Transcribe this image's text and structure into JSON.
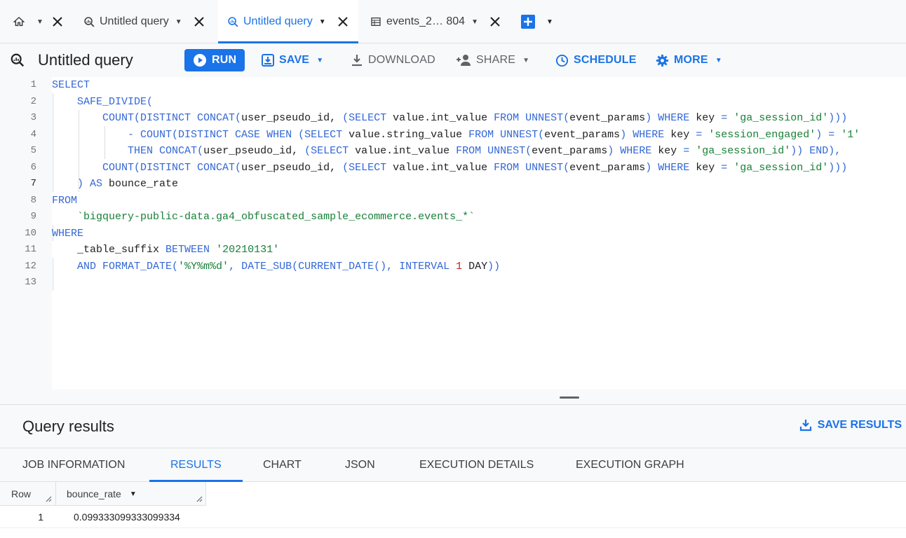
{
  "tabs": [
    {
      "label": "",
      "icon": "home-icon",
      "has_caret": true,
      "active": false
    },
    {
      "label": "Untitled query",
      "icon": "query-icon",
      "has_caret": true,
      "active": false
    },
    {
      "label": "Untitled query",
      "icon": "query-icon",
      "has_caret": true,
      "active": true
    },
    {
      "label": "events_2… 804",
      "icon": "table-icon",
      "has_caret": true,
      "active": false
    }
  ],
  "toolbar": {
    "title": "Untitled query",
    "run": "RUN",
    "save": "SAVE",
    "download": "DOWNLOAD",
    "share": "SHARE",
    "schedule": "SCHEDULE",
    "more": "MORE"
  },
  "editor": {
    "line_numbers": [
      "1",
      "2",
      "3",
      "4",
      "5",
      "6",
      "7",
      "8",
      "9",
      "10",
      "11",
      "12",
      "13"
    ],
    "lines": [
      [
        {
          "t": "SELECT",
          "c": "kw"
        }
      ],
      [
        {
          "t": "    ",
          "c": "tx"
        },
        {
          "t": "SAFE_DIVIDE(",
          "c": "kw"
        }
      ],
      [
        {
          "t": "        ",
          "c": "tx"
        },
        {
          "t": "COUNT(DISTINCT CONCAT(",
          "c": "kw"
        },
        {
          "t": "user_pseudo_id, ",
          "c": "tx"
        },
        {
          "t": "(SELECT ",
          "c": "kw"
        },
        {
          "t": "value.int_value ",
          "c": "tx"
        },
        {
          "t": "FROM UNNEST(",
          "c": "kw"
        },
        {
          "t": "event_params",
          "c": "tx"
        },
        {
          "t": ") WHERE ",
          "c": "kw"
        },
        {
          "t": "key ",
          "c": "tx"
        },
        {
          "t": "= ",
          "c": "kw"
        },
        {
          "t": "'ga_session_id'",
          "c": "st"
        },
        {
          "t": ")))",
          "c": "kw"
        }
      ],
      [
        {
          "t": "            ",
          "c": "tx"
        },
        {
          "t": "- COUNT(DISTINCT CASE WHEN (SELECT ",
          "c": "kw"
        },
        {
          "t": "value.string_value ",
          "c": "tx"
        },
        {
          "t": "FROM UNNEST(",
          "c": "kw"
        },
        {
          "t": "event_params",
          "c": "tx"
        },
        {
          "t": ") WHERE ",
          "c": "kw"
        },
        {
          "t": "key ",
          "c": "tx"
        },
        {
          "t": "= ",
          "c": "kw"
        },
        {
          "t": "'session_engaged'",
          "c": "st"
        },
        {
          "t": ") = ",
          "c": "kw"
        },
        {
          "t": "'1'",
          "c": "st"
        }
      ],
      [
        {
          "t": "            ",
          "c": "tx"
        },
        {
          "t": "THEN CONCAT(",
          "c": "kw"
        },
        {
          "t": "user_pseudo_id, ",
          "c": "tx"
        },
        {
          "t": "(SELECT ",
          "c": "kw"
        },
        {
          "t": "value.int_value ",
          "c": "tx"
        },
        {
          "t": "FROM UNNEST(",
          "c": "kw"
        },
        {
          "t": "event_params",
          "c": "tx"
        },
        {
          "t": ") WHERE ",
          "c": "kw"
        },
        {
          "t": "key ",
          "c": "tx"
        },
        {
          "t": "= ",
          "c": "kw"
        },
        {
          "t": "'ga_session_id'",
          "c": "st"
        },
        {
          "t": ")) END),",
          "c": "kw"
        }
      ],
      [
        {
          "t": "        ",
          "c": "tx"
        },
        {
          "t": "COUNT(DISTINCT CONCAT(",
          "c": "kw"
        },
        {
          "t": "user_pseudo_id, ",
          "c": "tx"
        },
        {
          "t": "(SELECT ",
          "c": "kw"
        },
        {
          "t": "value.int_value ",
          "c": "tx"
        },
        {
          "t": "FROM UNNEST(",
          "c": "kw"
        },
        {
          "t": "event_params",
          "c": "tx"
        },
        {
          "t": ") WHERE ",
          "c": "kw"
        },
        {
          "t": "key ",
          "c": "tx"
        },
        {
          "t": "= ",
          "c": "kw"
        },
        {
          "t": "'ga_session_id'",
          "c": "st"
        },
        {
          "t": ")))",
          "c": "kw"
        }
      ],
      [
        {
          "t": "    ",
          "c": "tx"
        },
        {
          "t": ") AS ",
          "c": "kw"
        },
        {
          "t": "bounce_rate",
          "c": "tx"
        }
      ],
      [
        {
          "t": "FROM",
          "c": "kw"
        }
      ],
      [
        {
          "t": "    ",
          "c": "tx"
        },
        {
          "t": "`bigquery-public-data.ga4_obfuscated_sample_ecommerce.events_*`",
          "c": "st"
        }
      ],
      [
        {
          "t": "WHERE",
          "c": "kw"
        }
      ],
      [
        {
          "t": "    ",
          "c": "tx"
        },
        {
          "t": "_table_suffix ",
          "c": "tx"
        },
        {
          "t": "BETWEEN ",
          "c": "kw"
        },
        {
          "t": "'20210131'",
          "c": "st"
        }
      ],
      [
        {
          "t": "    ",
          "c": "tx"
        },
        {
          "t": "AND FORMAT_DATE(",
          "c": "kw"
        },
        {
          "t": "'%Y%m%d'",
          "c": "st"
        },
        {
          "t": ", DATE_SUB(CURRENT_DATE(), INTERVAL ",
          "c": "kw"
        },
        {
          "t": "1",
          "c": "nm"
        },
        {
          "t": " ",
          "c": "tx"
        },
        {
          "t": "DAY",
          "c": "tx"
        },
        {
          "t": "))",
          "c": "kw"
        }
      ],
      []
    ]
  },
  "results": {
    "title": "Query results",
    "save_results": "SAVE RESULTS",
    "tabs": [
      "JOB INFORMATION",
      "RESULTS",
      "CHART",
      "JSON",
      "EXECUTION DETAILS",
      "EXECUTION GRAPH"
    ],
    "active_tab": "RESULTS",
    "columns": [
      "Row",
      "bounce_rate"
    ],
    "rows": [
      [
        "1",
        "0.099333099333099334"
      ]
    ]
  },
  "colors": {
    "keyword": "#3367d6",
    "string": "#188038",
    "number": "#c5221f",
    "text": "#202124",
    "accent": "#1a73e8"
  }
}
